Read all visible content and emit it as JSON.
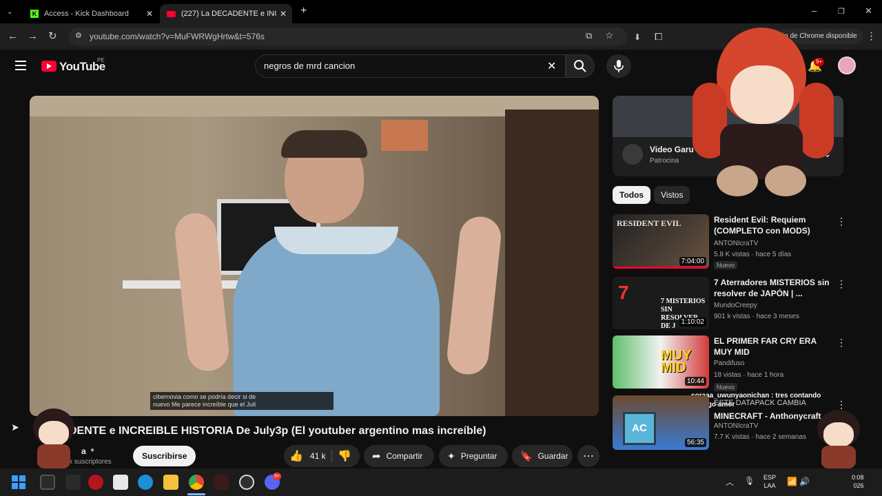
{
  "browser": {
    "tabs": [
      {
        "title": "Access - Kick Dashboard"
      },
      {
        "title": "(227) La DECADENTE e INCREIB"
      }
    ],
    "url": "youtube.com/watch?v=MuFWRWgHrtw&t=576s",
    "update_notice": "rsión de Chrome disponible"
  },
  "youtube": {
    "logo_text": "YouTube",
    "region": "PE",
    "search_value": "negros de mrd cancion",
    "notifications_badge": "9+"
  },
  "video": {
    "caption_line1": "cibernovia como se podría decir si de",
    "caption_line2": "nuevo Me parece increíble que el Juli",
    "title": "DENTE e INCREIBLE HISTORIA De July3p (El youtuber argentino mas increíble)",
    "channel": "a",
    "subscribers": "k suscriptores",
    "subscribe_label": "Suscribirse",
    "likes": "41 k",
    "share_label": "Compartir",
    "ask_label": "Preguntar",
    "save_label": "Guardar"
  },
  "sidebar": {
    "ad_title": "Video Garu",
    "ad_sponsor": "Patrocina",
    "chips": [
      "Todos",
      "Vistos"
    ],
    "items": [
      {
        "title": "Resident Evil: Requiem (COMPLETO con MODS)",
        "channel": "ANTONIcraTV",
        "meta": "5.8 K vistas · hace 5 días",
        "badge": "Nuevo",
        "duration": "7:04:00",
        "thumb_text": "RESIDENT EVIL"
      },
      {
        "title": "7 Aterradores MISTERIOS sin resolver de JAPÓN | ...",
        "channel": "MundoCreepy",
        "meta": "901 k vistas · hace 3 meses",
        "badge": "",
        "duration": "1:10:02",
        "thumb_text": "7 MISTERIOS SIN RESOLVER DE J"
      },
      {
        "title": "EL PRIMER FAR CRY ERA MUY MID",
        "channel": "Pandifuso",
        "meta": "18 vistas · hace 1 hora",
        "badge": "Nuevo",
        "duration": "10:44",
        "thumb_text": "MUY MID"
      },
      {
        "title": "MINECRAFT - Anthonycraft",
        "channel": "ANTONIcraTV",
        "meta": "7.7 K vistas · hace 2 semanas",
        "badge": "",
        "duration": "56:35",
        "thumb_text": "AC"
      }
    ],
    "overlay_chat": "soraaa_uwunyaonichan : tres contando contigo amor",
    "overlay_chat2": "ESTE DATAPACK CAMBIA"
  },
  "taskbar": {
    "lang": "ESP",
    "lang2": "LAA",
    "time": "0:08",
    "date": "026",
    "discord_badge": "9+"
  },
  "colors": {
    "yt_red": "#ff0033",
    "kick_green": "#53fc18",
    "accent_blue": "#3ea6ff"
  }
}
